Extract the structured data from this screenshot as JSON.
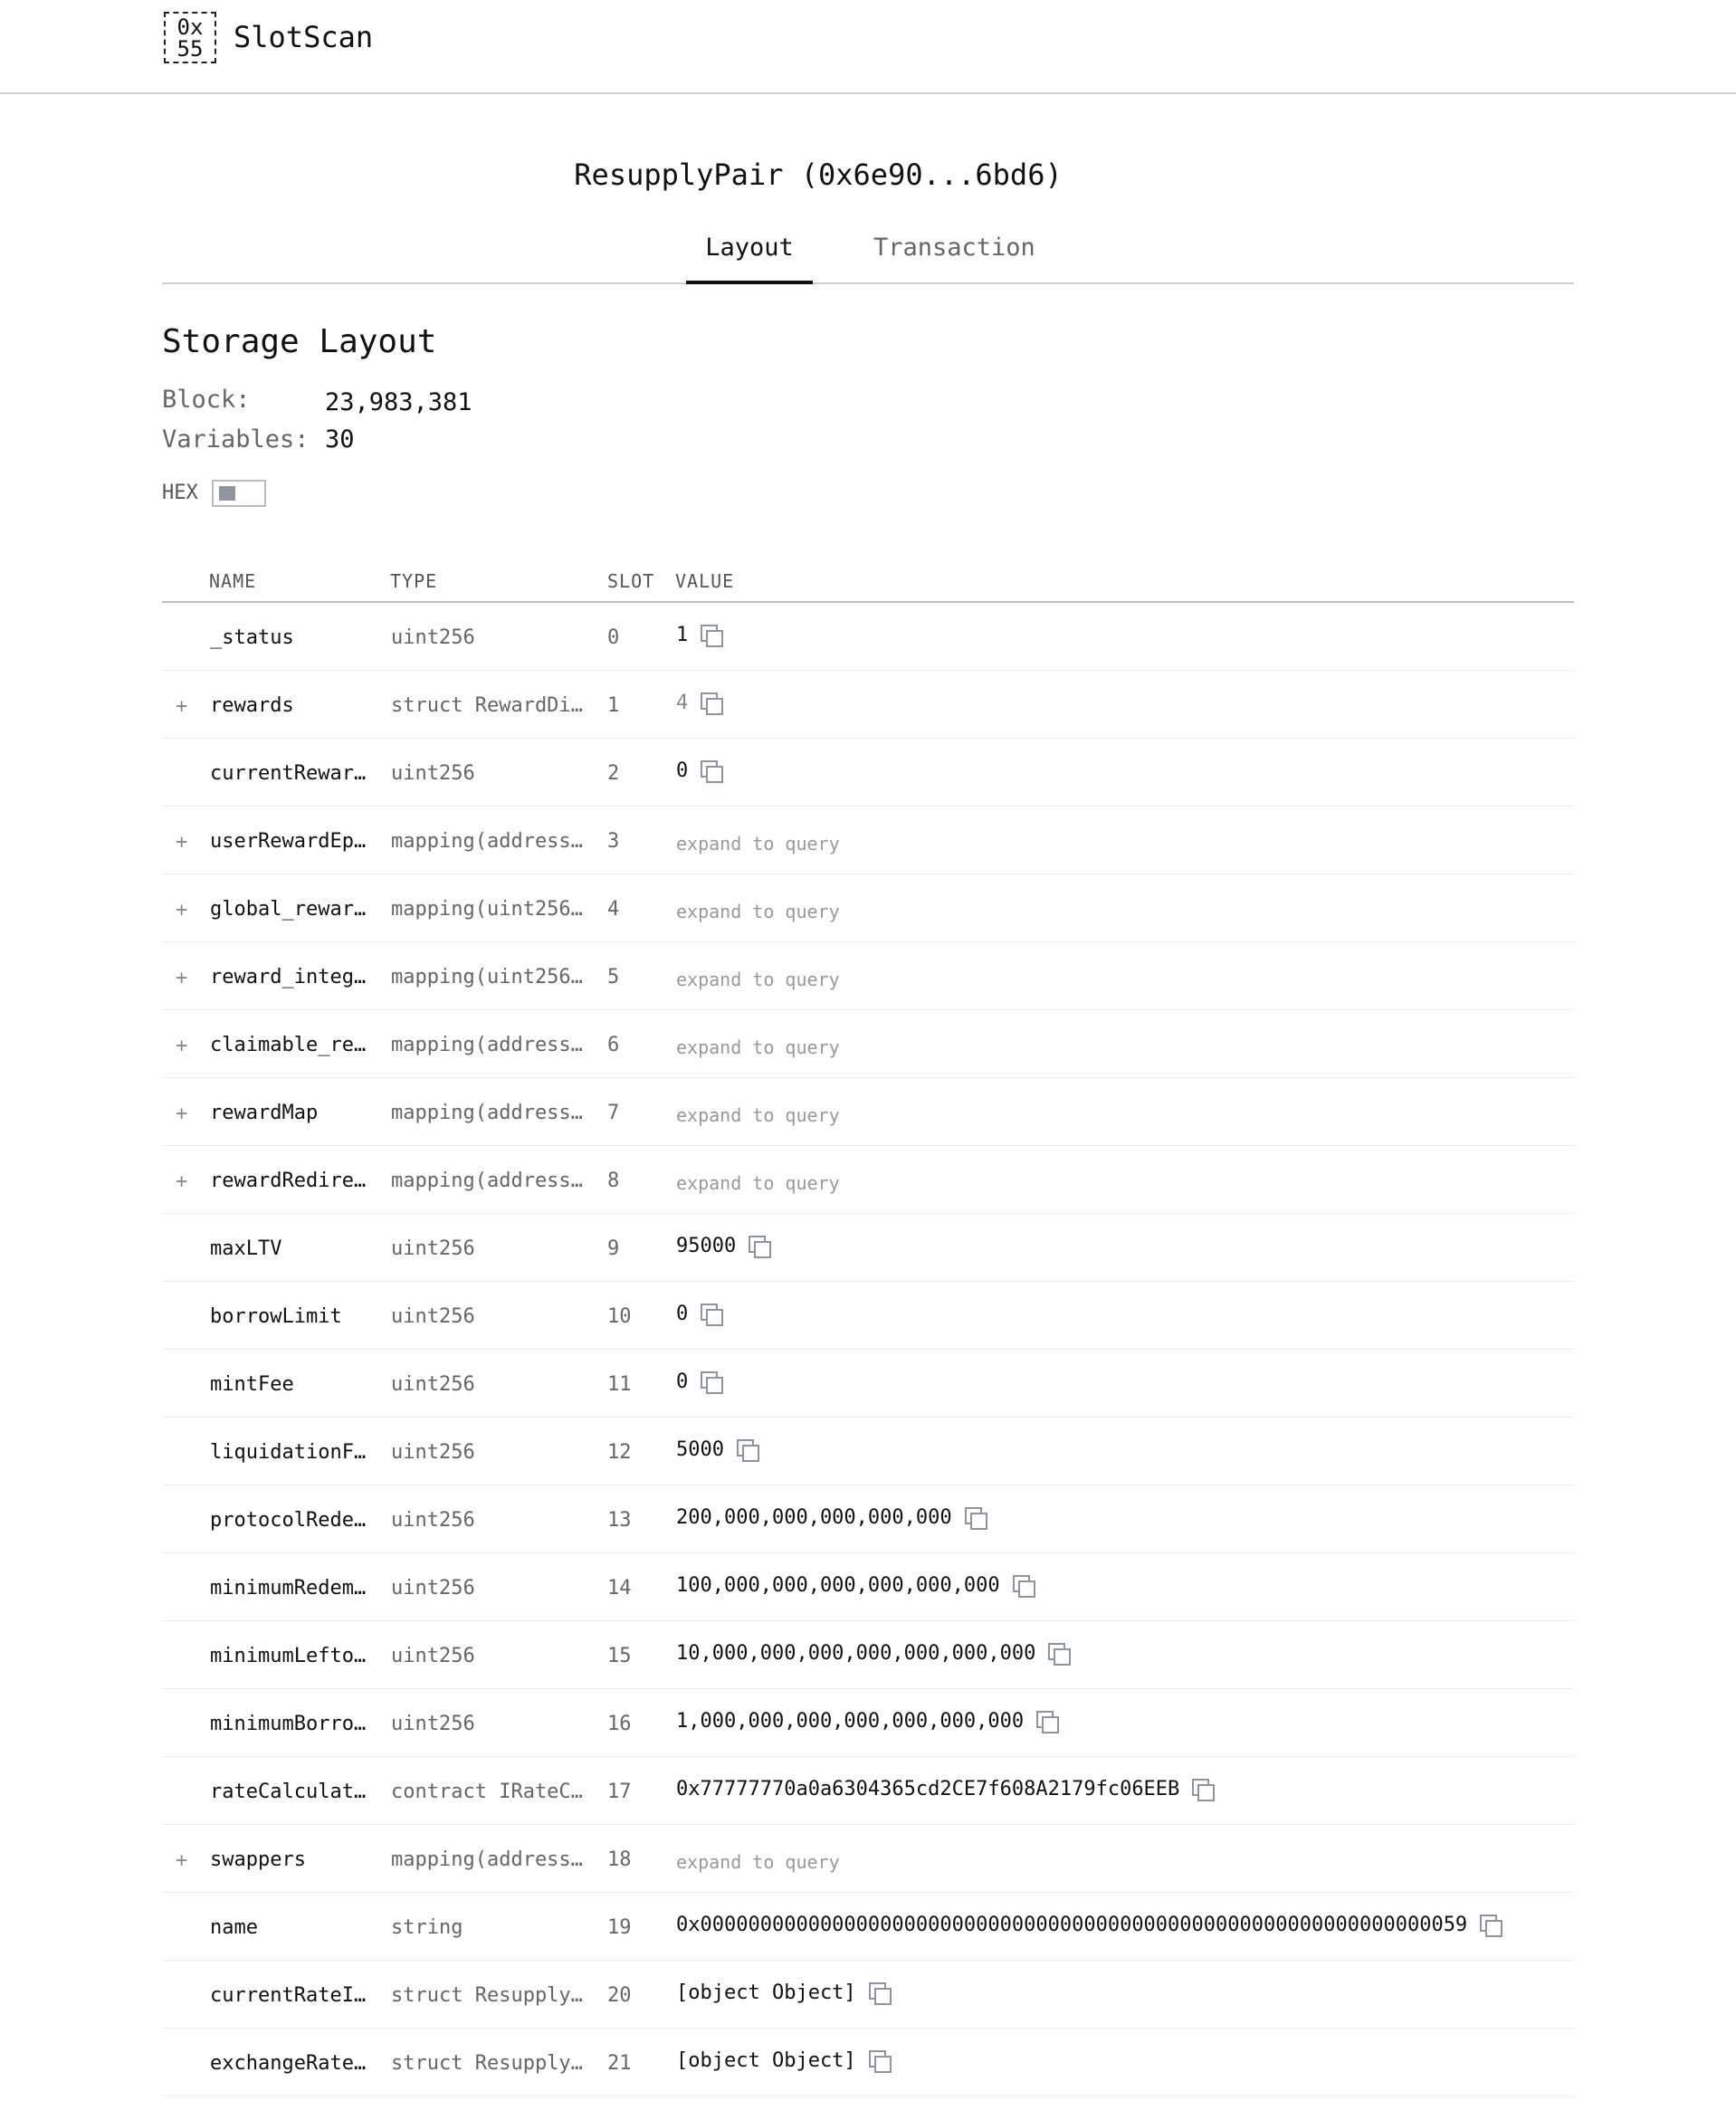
{
  "header": {
    "logo_line1": "0x",
    "logo_line2": "55",
    "brand": "SlotScan"
  },
  "contract_title": "ResupplyPair (0x6e90...6bd6)",
  "tabs": [
    {
      "label": "Layout",
      "active": true
    },
    {
      "label": "Transaction",
      "active": false
    }
  ],
  "storage": {
    "title": "Storage Layout",
    "block_label": "Block:",
    "block_value": "23,983,381",
    "variables_label": "Variables:",
    "variables_value": "30",
    "hex_label": "HEX"
  },
  "table": {
    "headers": {
      "name": "NAME",
      "type": "TYPE",
      "slot": "SLOT",
      "value": "VALUE"
    },
    "rows": [
      {
        "expand": "",
        "name": "_status",
        "type": "uint256",
        "slot": "0",
        "value": "1",
        "kind": "value"
      },
      {
        "expand": "+",
        "name": "rewards",
        "type": "struct RewardDi…",
        "slot": "1",
        "value": "4",
        "kind": "dim"
      },
      {
        "expand": "",
        "name": "currentRewar…",
        "type": "uint256",
        "slot": "2",
        "value": "0",
        "kind": "value"
      },
      {
        "expand": "+",
        "name": "userRewardEp…",
        "type": "mapping(address…",
        "slot": "3",
        "value": "expand to query",
        "kind": "query"
      },
      {
        "expand": "+",
        "name": "global_rewar…",
        "type": "mapping(uint256…",
        "slot": "4",
        "value": "expand to query",
        "kind": "query"
      },
      {
        "expand": "+",
        "name": "reward_integ…",
        "type": "mapping(uint256…",
        "slot": "5",
        "value": "expand to query",
        "kind": "query"
      },
      {
        "expand": "+",
        "name": "claimable_re…",
        "type": "mapping(address…",
        "slot": "6",
        "value": "expand to query",
        "kind": "query"
      },
      {
        "expand": "+",
        "name": "rewardMap",
        "type": "mapping(address…",
        "slot": "7",
        "value": "expand to query",
        "kind": "query"
      },
      {
        "expand": "+",
        "name": "rewardRedire…",
        "type": "mapping(address…",
        "slot": "8",
        "value": "expand to query",
        "kind": "query"
      },
      {
        "expand": "",
        "name": "maxLTV",
        "type": "uint256",
        "slot": "9",
        "value": "95000",
        "kind": "value"
      },
      {
        "expand": "",
        "name": "borrowLimit",
        "type": "uint256",
        "slot": "10",
        "value": "0",
        "kind": "value"
      },
      {
        "expand": "",
        "name": "mintFee",
        "type": "uint256",
        "slot": "11",
        "value": "0",
        "kind": "value"
      },
      {
        "expand": "",
        "name": "liquidationF…",
        "type": "uint256",
        "slot": "12",
        "value": "5000",
        "kind": "value"
      },
      {
        "expand": "",
        "name": "protocolRede…",
        "type": "uint256",
        "slot": "13",
        "value": "200,000,000,000,000,000",
        "kind": "value"
      },
      {
        "expand": "",
        "name": "minimumRedem…",
        "type": "uint256",
        "slot": "14",
        "value": "100,000,000,000,000,000,000",
        "kind": "value"
      },
      {
        "expand": "",
        "name": "minimumLefto…",
        "type": "uint256",
        "slot": "15",
        "value": "10,000,000,000,000,000,000,000",
        "kind": "value"
      },
      {
        "expand": "",
        "name": "minimumBorro…",
        "type": "uint256",
        "slot": "16",
        "value": "1,000,000,000,000,000,000,000",
        "kind": "value"
      },
      {
        "expand": "",
        "name": "rateCalculat…",
        "type": "contract IRateC…",
        "slot": "17",
        "value": "0x77777770a0a6304365cd2CE7f608A2179fc06EEB",
        "kind": "value"
      },
      {
        "expand": "+",
        "name": "swappers",
        "type": "mapping(address…",
        "slot": "18",
        "value": "expand to query",
        "kind": "query"
      },
      {
        "expand": "",
        "name": "name",
        "type": "string",
        "slot": "19",
        "value": "0x0000000000000000000000000000000000000000000000000000000000000059",
        "kind": "value"
      },
      {
        "expand": "",
        "name": "currentRateI…",
        "type": "struct Resupply…",
        "slot": "20",
        "value": "[object Object]",
        "kind": "value"
      },
      {
        "expand": "",
        "name": "exchangeRate…",
        "type": "struct Resupply…",
        "slot": "21",
        "value": "[object Object]",
        "kind": "value"
      }
    ]
  }
}
